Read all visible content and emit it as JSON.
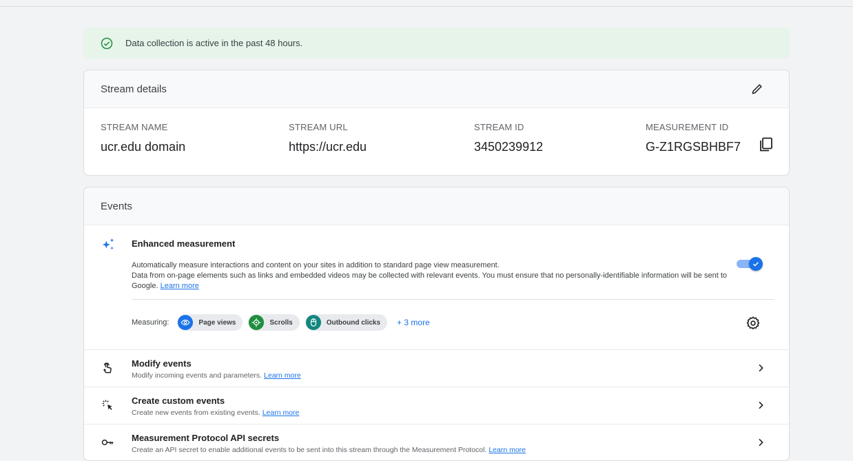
{
  "banner": {
    "text": "Data collection is active in the past 48 hours.",
    "icon": "check-circle-icon",
    "color": "#1e8e3e"
  },
  "stream": {
    "title": "Stream details",
    "fields": [
      {
        "label": "STREAM NAME",
        "value": "ucr.edu domain"
      },
      {
        "label": "STREAM URL",
        "value": "https://ucr.edu"
      },
      {
        "label": "STREAM ID",
        "value": "3450239912"
      },
      {
        "label": "MEASUREMENT ID",
        "value": "G-Z1RGSBHBF7"
      }
    ]
  },
  "events": {
    "title": "Events",
    "enhanced": {
      "title": "Enhanced measurement",
      "line1": "Automatically measure interactions and content on your sites in addition to standard page view measurement.",
      "line2": "Data from on-page elements such as links and embedded videos may be collected with relevant events. You must ensure that no personally-identifiable information will be sent to Google.",
      "learn_more": "Learn more",
      "enabled": true,
      "measuring_label": "Measuring:",
      "chips": [
        {
          "label": "Page views",
          "icon": "eye-icon",
          "color": "#1a73e8"
        },
        {
          "label": "Scrolls",
          "icon": "scroll-target-icon",
          "color": "#1e8e3e"
        },
        {
          "label": "Outbound clicks",
          "icon": "mouse-icon",
          "color": "#12877f"
        }
      ],
      "more": "+ 3 more"
    },
    "rows": [
      {
        "title": "Modify events",
        "desc": "Modify incoming events and parameters.",
        "link": "Learn more",
        "icon": "touch-icon"
      },
      {
        "title": "Create custom events",
        "desc": "Create new events from existing events.",
        "link": "Learn more",
        "icon": "click-sparkle-icon"
      },
      {
        "title": "Measurement Protocol API secrets",
        "desc": "Create an API secret to enable additional events to be sent into this stream through the Measurement Protocol.",
        "link": "Learn more",
        "icon": "key-icon"
      }
    ]
  },
  "colors": {
    "accent": "#1a73e8",
    "banner_bg": "#e6f4ea"
  }
}
